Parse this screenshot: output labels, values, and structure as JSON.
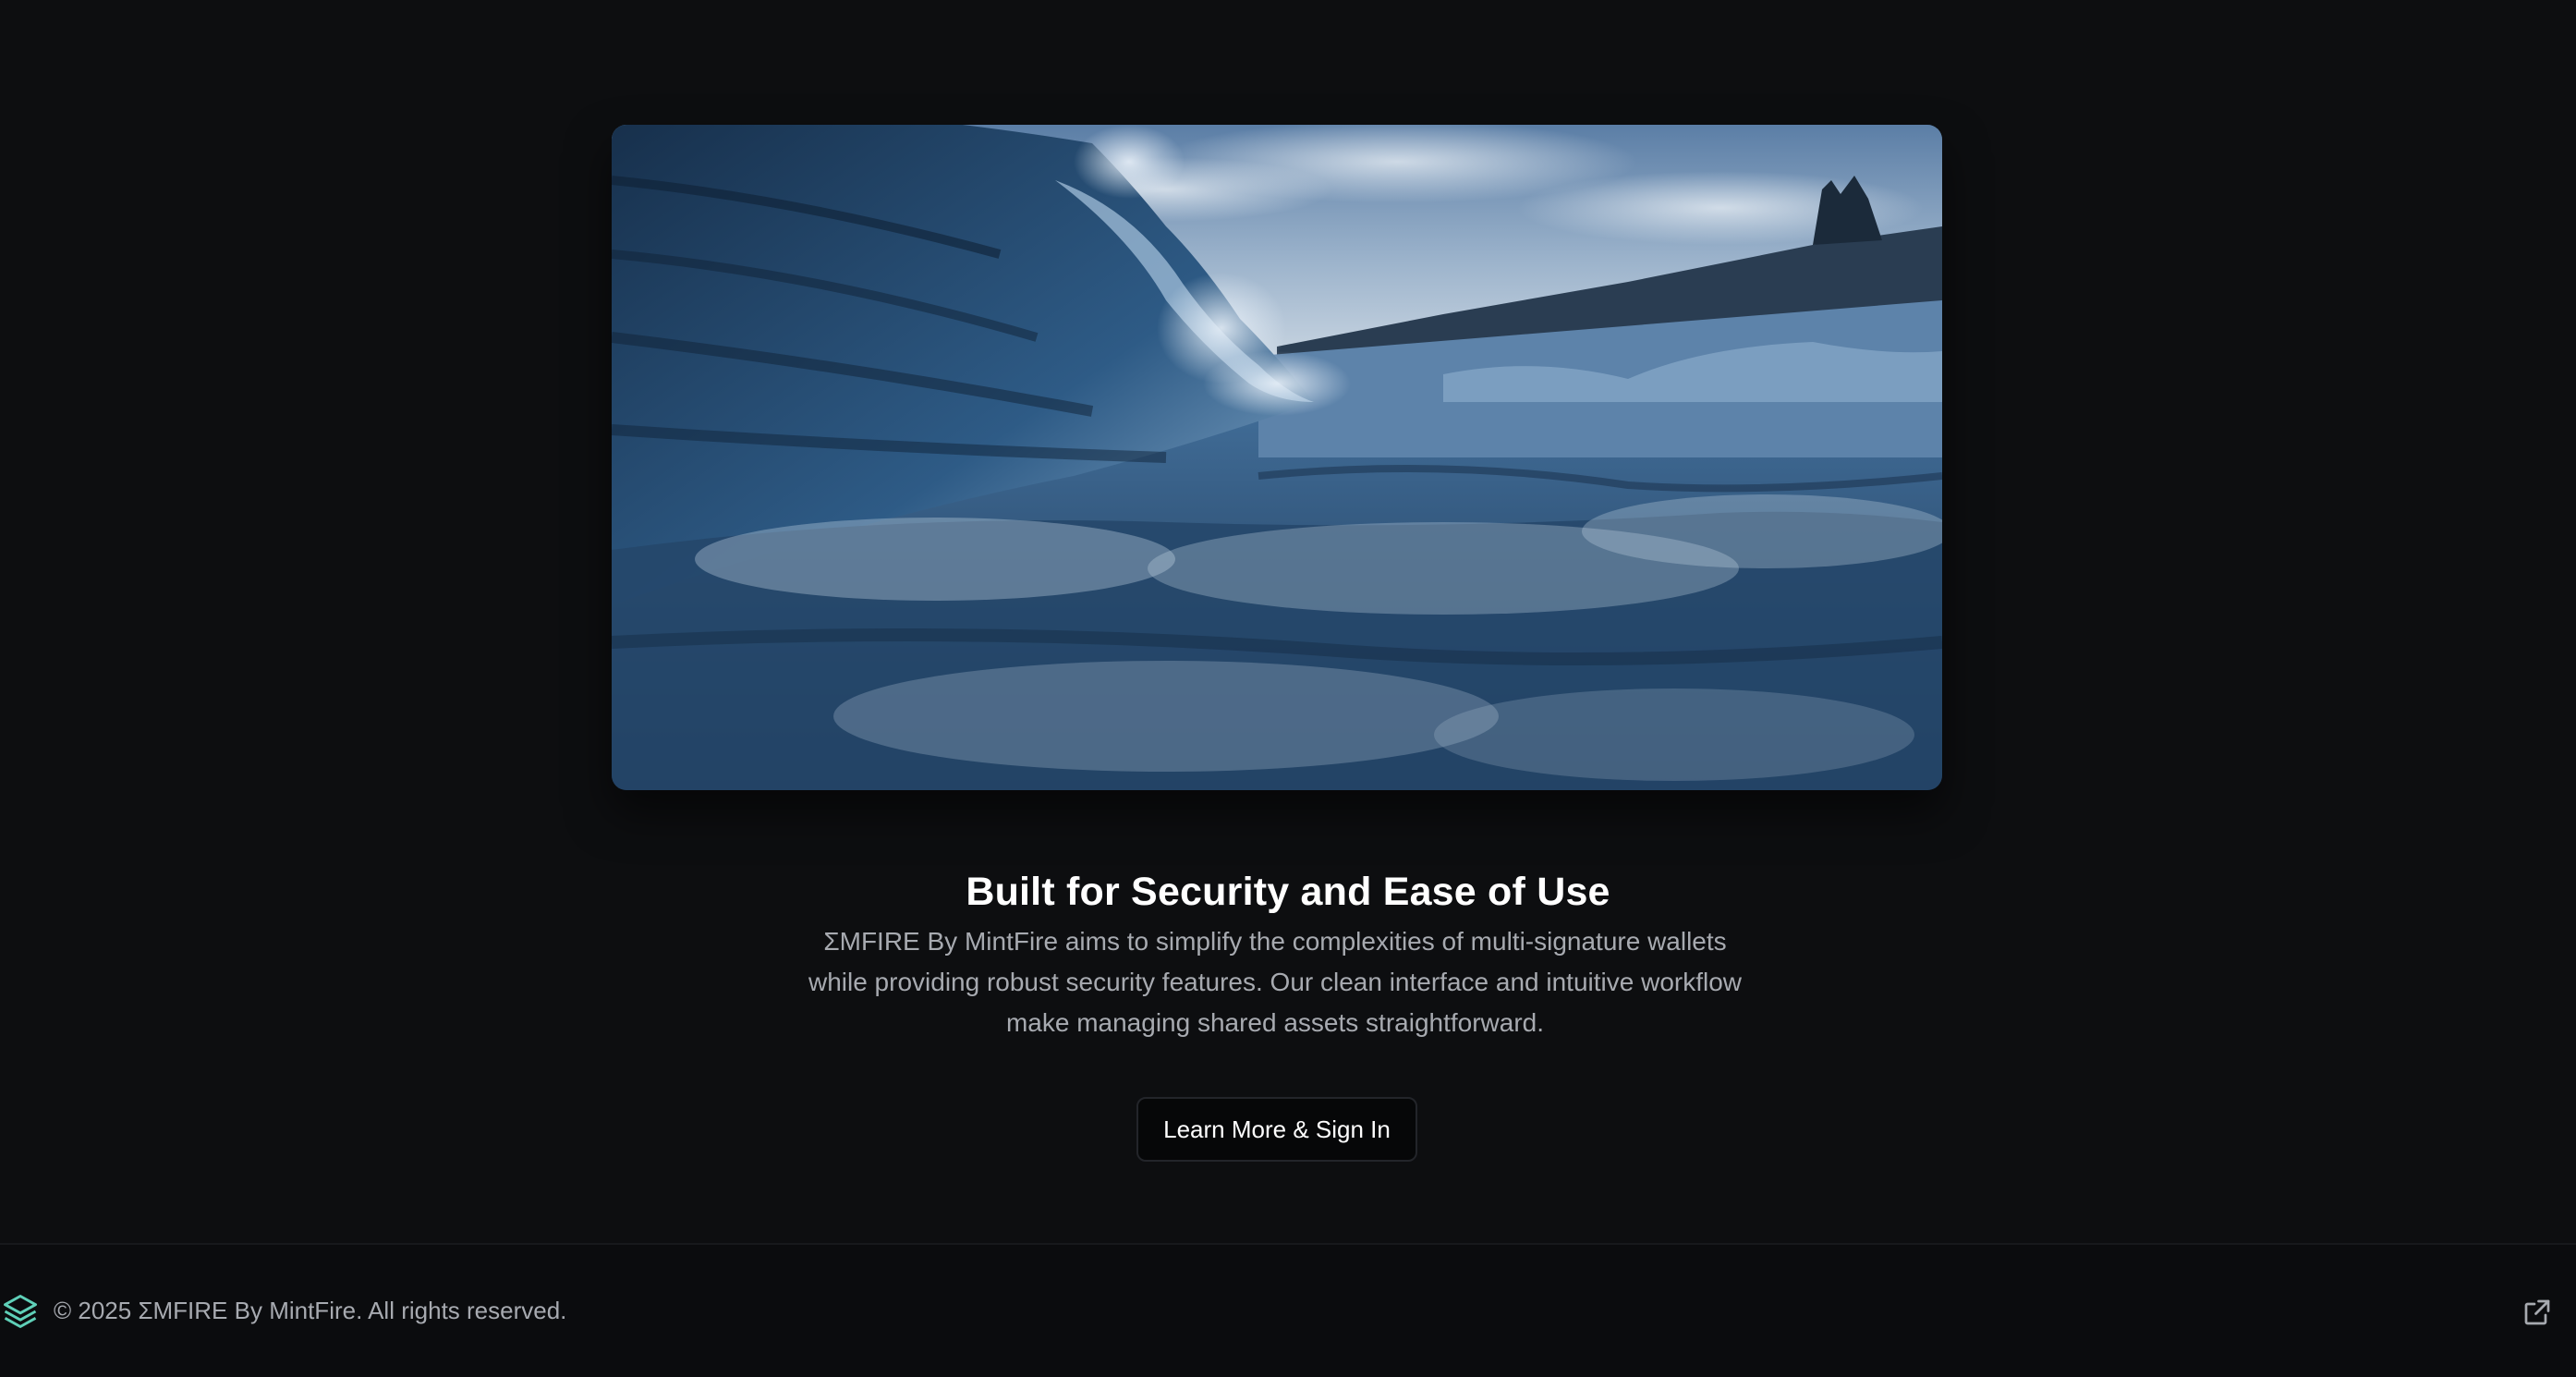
{
  "hero": {
    "image": "ocean-wave-photo"
  },
  "section": {
    "title": "Built for Security and Ease of Use",
    "description_lines": [
      "ΣMFIRE By MintFire aims to simplify the complexities of multi-signature wallets",
      "while providing robust security features. Our clean interface and intuitive workflow",
      "make managing shared assets straightforward."
    ],
    "cta_label": "Learn More & Sign In"
  },
  "footer": {
    "logo_icon": "layers-icon",
    "copyright": "© 2025 ΣMFIRE By MintFire. All rights reserved.",
    "link_icon": "external-link-icon"
  },
  "colors": {
    "background": "#0d0e10",
    "accent": "#5fd0b8",
    "muted_text": "#a7aab0"
  }
}
